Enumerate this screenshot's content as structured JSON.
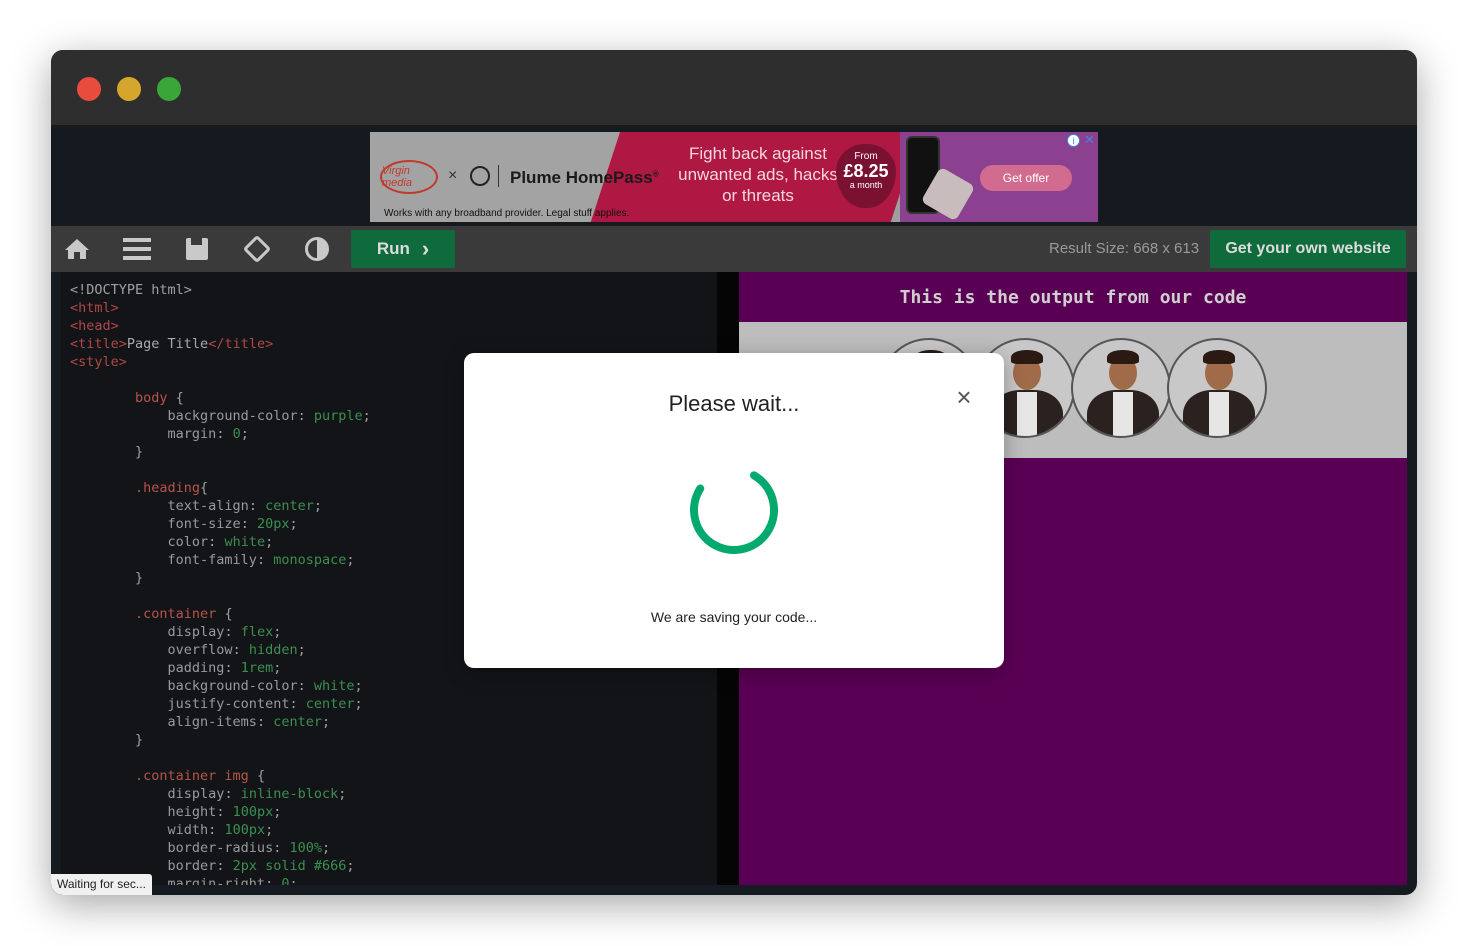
{
  "ad": {
    "brand_virgin": "Virgin media",
    "times": "×",
    "plume": "Plume HomePass",
    "plume_mark": "®",
    "footnote": "Works with any broadband provider. Legal stuff applies.",
    "headline": "Fight back against unwanted ads, hacks or threats",
    "from": "From",
    "price": "£8.25",
    "per": "a month",
    "cta": "Get offer",
    "info": "i",
    "close": "✕"
  },
  "toolbar": {
    "run_label": "Run",
    "run_chevron": "›",
    "result_size": "Result Size: 668 x 613",
    "own_website": "Get your own website"
  },
  "editor": {
    "lines": [
      "<!DOCTYPE html>",
      "<html>",
      "<head>",
      "<title>Page Title</title>",
      "<style>",
      "",
      "        body {",
      "            background-color: purple;",
      "            margin: 0;",
      "        }",
      "",
      "        .heading{",
      "            text-align: center;",
      "            font-size: 20px;",
      "            color: white;",
      "            font-family: monospace;",
      "        }",
      "",
      "        .container {",
      "            display: flex;",
      "            overflow: hidden;",
      "            padding: 1rem;",
      "            background-color: white;",
      "            justify-content: center;",
      "            align-items: center;",
      "        }",
      "",
      "        .container img {",
      "            display: inline-block;",
      "            height: 100px;",
      "            width: 100px;",
      "            border-radius: 100%;",
      "            border: 2px solid #666;",
      "            margin-right: 0;"
    ]
  },
  "result": {
    "heading": "This is the output from our code",
    "avatar_count": 4
  },
  "status": {
    "waiting": "Waiting for sec..."
  },
  "modal": {
    "title": "Please wait...",
    "close": "×",
    "message": "We are saving your code...",
    "spinner_color": "#04aa6d"
  },
  "colors": {
    "accent_green": "#0f6b3c",
    "output_purple": "#5a0054"
  }
}
